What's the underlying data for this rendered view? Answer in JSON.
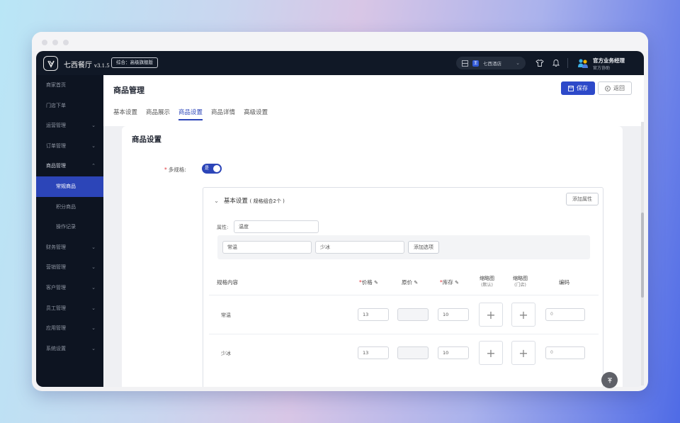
{
  "app": {
    "brand": "七西餐厅",
    "version": "v3.1.5",
    "edition": "综合：高级旗舰版",
    "store": "七西酒店",
    "store_badge": "王",
    "user_name": "官方业务经理",
    "user_role": "官方协助"
  },
  "sidebar": {
    "items": [
      {
        "label": "商家首页",
        "chevron": ""
      },
      {
        "label": "门店下单",
        "chevron": ""
      },
      {
        "label": "运营管理",
        "chevron": "⌄"
      },
      {
        "label": "订单管理",
        "chevron": "⌄"
      },
      {
        "label": "商品管理",
        "chevron": "⌃"
      },
      {
        "label": "常规商品",
        "chevron": ""
      },
      {
        "label": "积分商品",
        "chevron": ""
      },
      {
        "label": "操作记录",
        "chevron": ""
      },
      {
        "label": "财务管理",
        "chevron": "⌄"
      },
      {
        "label": "营销管理",
        "chevron": "⌄"
      },
      {
        "label": "客户管理",
        "chevron": "⌄"
      },
      {
        "label": "员工管理",
        "chevron": "⌄"
      },
      {
        "label": "应用管理",
        "chevron": "⌄"
      },
      {
        "label": "系统设置",
        "chevron": "⌄"
      }
    ]
  },
  "page": {
    "title": "商品管理",
    "save_label": "保存",
    "back_label": "返回",
    "tabs": [
      "基本设置",
      "商品展示",
      "商品设置",
      "商品详情",
      "高级设置"
    ],
    "active_tab": "商品设置"
  },
  "settings": {
    "card_title": "商品设置",
    "multi_spec_label": "多规格:",
    "multi_spec_required": "*",
    "toggle_text": "是",
    "basic_title": "基本设置",
    "basic_count": "( 规格组合2个 )",
    "add_attr_label": "添加属性",
    "attr_label": "属性:",
    "attr_value": "温度",
    "options": [
      "常温",
      "少冰"
    ],
    "add_option_label": "添加选项"
  },
  "table": {
    "headers": {
      "spec": "规格内容",
      "price": "价格",
      "original_price": "原价",
      "stock": "库存",
      "thumb_default": "缩略图",
      "thumb_default_sub": "(默认)",
      "thumb_store": "缩略图",
      "thumb_store_sub": "(门店)",
      "code": "编码"
    },
    "required_mark": "*",
    "rows": [
      {
        "spec": "常温",
        "price": "13",
        "original_price": "",
        "stock": "10",
        "code": "0"
      },
      {
        "spec": "少冰",
        "price": "13",
        "original_price": "",
        "stock": "10",
        "code": "0"
      }
    ],
    "plus": "+"
  },
  "colors": {
    "accent": "#2c45b8",
    "sidebar_bg": "#0d1421",
    "required": "#e0393e"
  }
}
